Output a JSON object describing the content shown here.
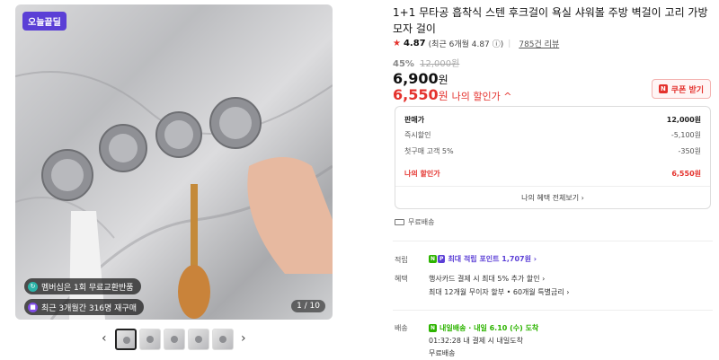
{
  "gallery": {
    "badge": "오늘끝딜",
    "promo1": "멤버십은 1회 무료교환반품",
    "promo2": "최근 3개월간 316명 재구매",
    "counter": "1 / 10",
    "thumbnails": 5,
    "prev_icon": "chevron-left-icon",
    "next_icon": "chevron-right-icon"
  },
  "product": {
    "title": "1+1 무타공 흡착식 스텐 후크걸이 욕실 샤워볼 주방 벽걸이 고리 가방 모자 걸이",
    "rating": "4.87",
    "rating_note": "(최근 6개월 4.87",
    "reviews": "785건 리뷰",
    "discount_pct": "45%",
    "original_price": "12,000원",
    "price": "6,900",
    "price_unit": "원",
    "my_price": "6,550",
    "my_price_unit": "원",
    "my_price_label": "나의 할인가 ^",
    "coupon_label": "쿠폰 받기"
  },
  "breakdown": {
    "rows": [
      {
        "label": "판매가",
        "value": "12,000원"
      },
      {
        "label": "즉시할인",
        "value": "-5,100원"
      },
      {
        "label": "첫구매 고객 5%",
        "value": "-350원"
      },
      {
        "label": "나의 할인가",
        "value": "6,550원"
      }
    ],
    "more": "나의 혜택 전체보기 ›"
  },
  "shipping_top": "무료배송",
  "info": {
    "points_label": "적립",
    "points_value": "최대 적립 포인트 1,707원 ›",
    "benefit_label": "혜택",
    "benefit_line1": "행사카드 결제 시 최대 5% 추가 할인 ›",
    "benefit_line2": "최대 12개월 무이자 할부 • 60개월 특별금리 ›",
    "delivery_label": "배송",
    "delivery_line1": "내일배송 · 내일 6.10 (수) 도착",
    "delivery_line2": "01:32:28 내 결제 시 내일도착",
    "delivery_line3": "무료배송"
  },
  "colors": {
    "accent_red": "#e4322d",
    "purple": "#5b3fd6",
    "green": "#2db400"
  }
}
